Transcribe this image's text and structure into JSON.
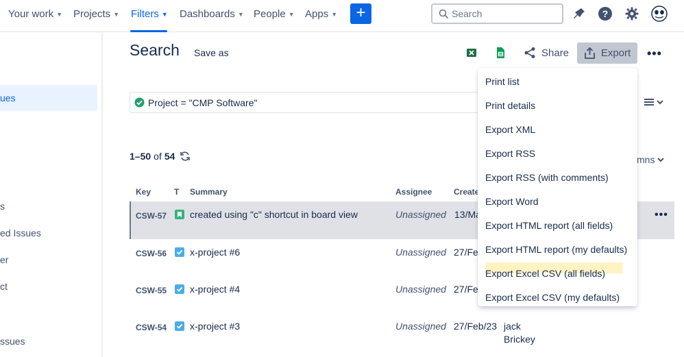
{
  "nav": {
    "items": [
      "Your work",
      "Projects",
      "Filters",
      "Dashboards",
      "People",
      "Apps"
    ],
    "active": "Filters",
    "create_label": "+",
    "search_placeholder": "Search"
  },
  "sidebar": {
    "items": [
      "ues",
      "s",
      "ed Issues",
      "er",
      "ct",
      "ssues"
    ]
  },
  "header": {
    "title": "Search",
    "save_as": "Save as",
    "share": "Share",
    "export": "Export"
  },
  "jql": {
    "text": "Project = \"CMP Software\""
  },
  "results": {
    "range": "1–50",
    "of": "of",
    "total": "54",
    "columns_label": "mns"
  },
  "table": {
    "headers": [
      "Key",
      "T",
      "Summary",
      "Assignee",
      "Create"
    ],
    "rows": [
      {
        "key": "CSW-57",
        "type": "story",
        "summary": "created using \"c\" shortcut in board view",
        "assignee": "Unassigned",
        "created": "13/Ma",
        "reporter_line1": "",
        "reporter_line2": ""
      },
      {
        "key": "CSW-56",
        "type": "task",
        "summary": "x-project #6",
        "assignee": "Unassigned",
        "created": "27/Fe",
        "reporter_line1": "",
        "reporter_line2": ""
      },
      {
        "key": "CSW-55",
        "type": "task",
        "summary": "x-project #4",
        "assignee": "Unassigned",
        "created": "27/Fe",
        "reporter_line1": "",
        "reporter_line2": ""
      },
      {
        "key": "CSW-54",
        "type": "task",
        "summary": "x-project #3",
        "assignee": "Unassigned",
        "created": "27/Feb/23",
        "reporter_line1": "jack",
        "reporter_line2": "Brickey"
      }
    ]
  },
  "export_menu": {
    "items": [
      "Print list",
      "Print details",
      "Export XML",
      "Export RSS",
      "Export RSS (with comments)",
      "Export Word",
      "Export HTML report (all fields)",
      "Export HTML report (my defaults)",
      "Export Excel CSV (all fields)",
      "Export Excel CSV (my defaults)"
    ],
    "highlighted": "Export Excel CSV (all fields)"
  },
  "colors": {
    "brand": "#0c66e4",
    "story": "#36b37e",
    "task": "#4bade8",
    "excel": "#1d6f42",
    "sheets": "#0f9d58",
    "check": "#22a06b"
  }
}
